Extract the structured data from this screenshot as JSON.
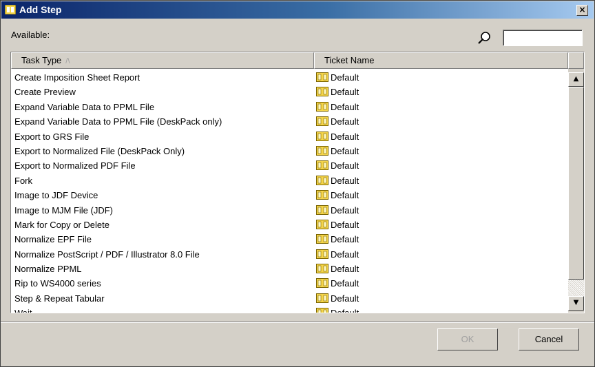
{
  "window": {
    "title": "Add Step",
    "close_label": "×"
  },
  "filter": {
    "label": "Available:",
    "search_value": ""
  },
  "table": {
    "columns": {
      "task_type": "Task Type",
      "ticket_name": "Ticket Name",
      "sort_indicator": "/\\"
    },
    "rows": [
      {
        "task": "Create Imposition Sheet Report",
        "ticket": "Default"
      },
      {
        "task": "Create Preview",
        "ticket": "Default"
      },
      {
        "task": "Expand Variable Data to PPML File",
        "ticket": "Default"
      },
      {
        "task": "Expand Variable Data to PPML File (DeskPack only)",
        "ticket": "Default"
      },
      {
        "task": "Export to GRS File",
        "ticket": "Default"
      },
      {
        "task": "Export to Normalized File (DeskPack Only)",
        "ticket": "Default"
      },
      {
        "task": "Export to Normalized PDF File",
        "ticket": "Default"
      },
      {
        "task": "Fork",
        "ticket": "Default"
      },
      {
        "task": "Image to JDF Device",
        "ticket": "Default"
      },
      {
        "task": "Image to MJM File (JDF)",
        "ticket": "Default"
      },
      {
        "task": "Mark for Copy or Delete",
        "ticket": "Default"
      },
      {
        "task": "Normalize EPF File",
        "ticket": "Default"
      },
      {
        "task": "Normalize PostScript / PDF / Illustrator 8.0 File",
        "ticket": "Default"
      },
      {
        "task": "Normalize PPML",
        "ticket": "Default"
      },
      {
        "task": "Rip to WS4000 series",
        "ticket": "Default"
      },
      {
        "task": "Step & Repeat Tabular",
        "ticket": "Default"
      },
      {
        "task": "Wait",
        "ticket": "Default"
      }
    ]
  },
  "buttons": {
    "ok": "OK",
    "cancel": "Cancel"
  },
  "colors": {
    "titlebar_start": "#0a246a",
    "titlebar_end": "#a6caf0",
    "ticket_icon": "#f5d54a",
    "dialog_bg": "#d4d0c8"
  },
  "icons": {
    "ticket": "ticket-icon",
    "search": "search-icon",
    "app": "app-icon"
  }
}
